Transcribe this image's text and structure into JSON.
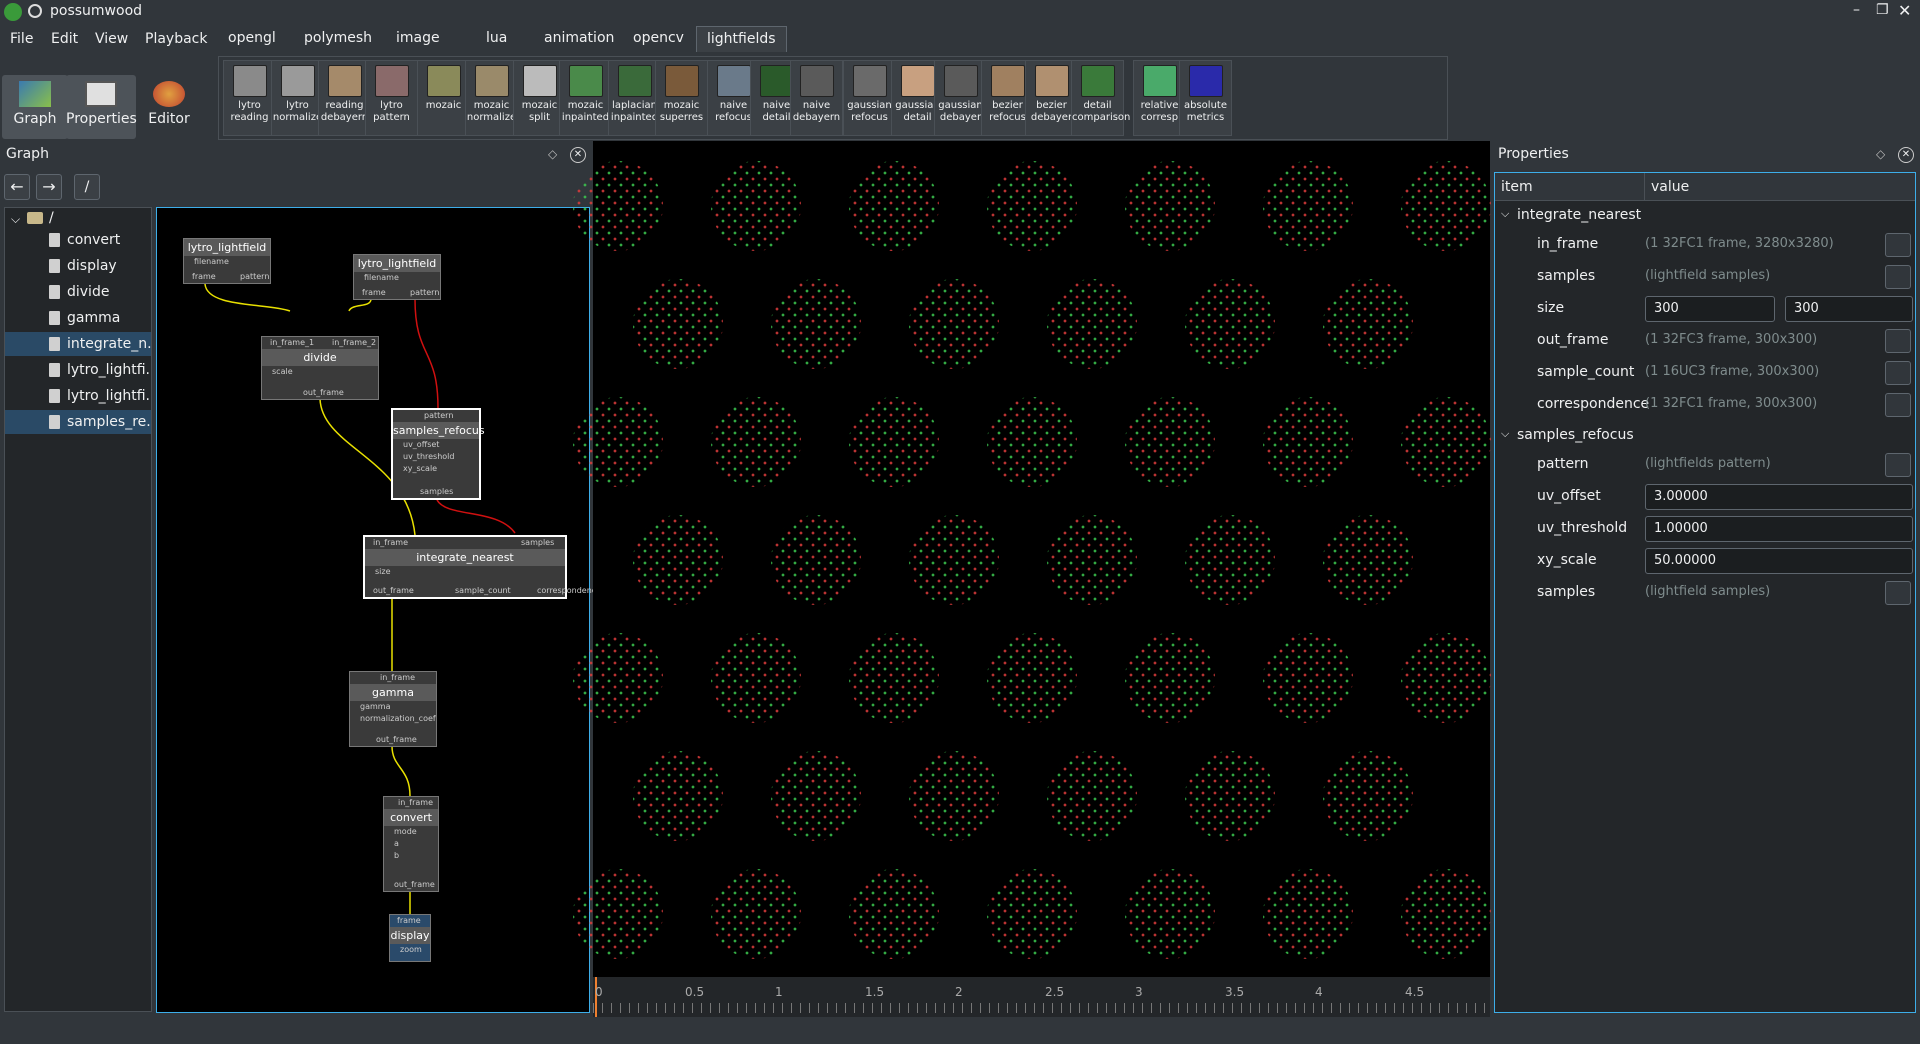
{
  "app": {
    "title": "possumwood"
  },
  "menu": [
    "File",
    "Edit",
    "View",
    "Playback"
  ],
  "tabs": [
    "opengl",
    "polymesh",
    "image",
    "lua",
    "animation",
    "opencv",
    "lightfields"
  ],
  "active_tab": "lightfields",
  "modes": [
    {
      "label": "Graph"
    },
    {
      "label": "Properties"
    },
    {
      "label": "Editor"
    }
  ],
  "tools": [
    {
      "label": "lytro\nreading",
      "color": "#8a8a8a"
    },
    {
      "label": "lytro\nnormalize",
      "color": "#9a9a9a"
    },
    {
      "label": "reading\ndebayern",
      "color": "#a58a6a"
    },
    {
      "label": "lytro\npattern",
      "color": "#8a6a6a"
    },
    {
      "label": "mozaic",
      "color": "#8a8a5a"
    },
    {
      "label": "mozaic\nnormalize",
      "color": "#9a8a6a"
    },
    {
      "label": "mozaic\nsplit",
      "color": "#bbbbbb"
    },
    {
      "label": "mozaic\ninpainted",
      "color": "#4a8a4a"
    },
    {
      "label": "laplacian\ninpainted",
      "color": "#3a6a3a"
    },
    {
      "label": "mozaic\nsuperres",
      "color": "#7a5a3a"
    },
    {
      "label": "naive\nrefocus",
      "color": "#6a7a8a"
    },
    {
      "label": "naive\ndetail",
      "color": "#2a5a2a"
    },
    {
      "label": "naive\ndebayern",
      "color": "#5a5a5a"
    },
    {
      "label": "gaussian\nrefocus",
      "color": "#6a6a6a"
    },
    {
      "label": "gaussian\ndetail",
      "color": "#c8a080"
    },
    {
      "label": "gaussian\ndebayer",
      "color": "#5a5a5a"
    },
    {
      "label": "bezier\nrefocus",
      "color": "#a08060"
    },
    {
      "label": "bezier\ndebayer",
      "color": "#b09070"
    },
    {
      "label": "detail\ncomparison",
      "color": "#3a7a3a"
    },
    {
      "label": "relative\ncorresp",
      "color": "#4aaa6a"
    },
    {
      "label": "absolute\nmetrics",
      "color": "#2a2aaa"
    }
  ],
  "graph_panel": {
    "title": "Graph",
    "path": "/",
    "root": "/"
  },
  "tree": [
    {
      "label": "convert",
      "selected": false
    },
    {
      "label": "display",
      "selected": false
    },
    {
      "label": "divide",
      "selected": false
    },
    {
      "label": "gamma",
      "selected": false
    },
    {
      "label": "integrate_n...",
      "selected": true
    },
    {
      "label": "lytro_lightfi...",
      "selected": false
    },
    {
      "label": "lytro_lightfi...",
      "selected": false
    },
    {
      "label": "samples_re...",
      "selected": true
    }
  ],
  "nodes": {
    "lytro1": {
      "title": "lytro_lightfield",
      "in": [
        "filename"
      ],
      "out": [
        "frame",
        "pattern"
      ]
    },
    "lytro2": {
      "title": "lytro_lightfield",
      "in": [
        "filename"
      ],
      "out": [
        "frame",
        "pattern"
      ]
    },
    "divide": {
      "title": "divide",
      "top": [
        "in_frame_1",
        "in_frame_2"
      ],
      "in": [
        "scale"
      ],
      "out": [
        "out_frame"
      ]
    },
    "samples_refocus": {
      "title": "samples_refocus",
      "top": [
        "pattern"
      ],
      "in": [
        "uv_offset",
        "uv_threshold",
        "xy_scale"
      ],
      "out": [
        "samples"
      ]
    },
    "integrate_nearest": {
      "title": "integrate_nearest",
      "top": [
        "in_frame",
        "samples"
      ],
      "in": [
        "size"
      ],
      "out": [
        "out_frame",
        "sample_count",
        "correspondence"
      ]
    },
    "gamma": {
      "title": "gamma",
      "top": [
        "in_frame"
      ],
      "in": [
        "gamma",
        "normalization_coef"
      ],
      "out": [
        "out_frame"
      ]
    },
    "convert": {
      "title": "convert",
      "top": [
        "in_frame"
      ],
      "in": [
        "mode",
        "a",
        "b"
      ],
      "out": [
        "out_frame"
      ]
    },
    "display": {
      "title": "display",
      "top": [
        "frame"
      ],
      "in": [
        "zoom"
      ]
    }
  },
  "ruler": {
    "ticks": [
      "0",
      "0.5",
      "1",
      "1.5",
      "2",
      "2.5",
      "3",
      "3.5",
      "4",
      "4.5"
    ]
  },
  "props_panel": {
    "title": "Properties",
    "col_item": "item",
    "col_value": "value"
  },
  "props": {
    "integrate_nearest": {
      "label": "integrate_nearest",
      "in_frame": {
        "k": "in_frame",
        "v": "(1 32FC1 frame, 3280x3280)"
      },
      "samples": {
        "k": "samples",
        "v": "(lightfield samples)"
      },
      "size": {
        "k": "size",
        "w": "300",
        "h": "300"
      },
      "out_frame": {
        "k": "out_frame",
        "v": "(1 32FC3 frame, 300x300)"
      },
      "sample_count": {
        "k": "sample_count",
        "v": "(1 16UC3 frame, 300x300)"
      },
      "correspondence": {
        "k": "correspondence",
        "v": "(1 32FC1 frame, 300x300)"
      }
    },
    "samples_refocus": {
      "label": "samples_refocus",
      "pattern": {
        "k": "pattern",
        "v": "(lightfields pattern)"
      },
      "uv_offset": {
        "k": "uv_offset",
        "v": "3.00000"
      },
      "uv_threshold": {
        "k": "uv_threshold",
        "v": "1.00000"
      },
      "xy_scale": {
        "k": "xy_scale",
        "v": "50.00000"
      },
      "samples": {
        "k": "samples",
        "v": "(lightfield samples)"
      }
    }
  }
}
